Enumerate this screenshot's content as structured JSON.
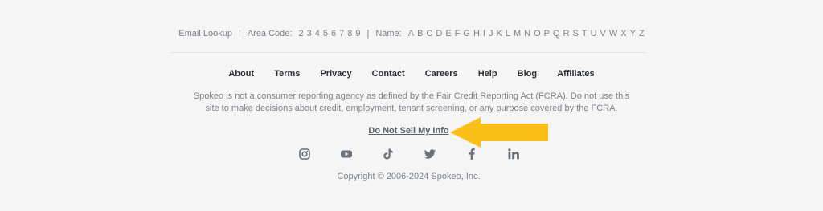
{
  "directory": {
    "email_lookup": "Email Lookup",
    "separator": "|",
    "area_code_label": "Area Code:",
    "area_codes": [
      "2",
      "3",
      "4",
      "5",
      "6",
      "7",
      "8",
      "9"
    ],
    "name_label": "Name:",
    "letters": [
      "A",
      "B",
      "C",
      "D",
      "E",
      "F",
      "G",
      "H",
      "I",
      "J",
      "K",
      "L",
      "M",
      "N",
      "O",
      "P",
      "Q",
      "R",
      "S",
      "T",
      "U",
      "V",
      "W",
      "X",
      "Y",
      "Z"
    ]
  },
  "nav": {
    "about": "About",
    "terms": "Terms",
    "privacy": "Privacy",
    "contact": "Contact",
    "careers": "Careers",
    "help": "Help",
    "blog": "Blog",
    "affiliates": "Affiliates"
  },
  "disclaimer": "Spokeo is not a consumer reporting agency as defined by the Fair Credit Reporting Act (FCRA). Do not use this site to make decisions about credit, employment, tenant screening, or any purpose covered by the FCRA.",
  "do_not_sell": "Do Not Sell My Info",
  "social": [
    "instagram-icon",
    "youtube-icon",
    "tiktok-icon",
    "twitter-icon",
    "facebook-icon",
    "linkedin-icon"
  ],
  "copyright": "Copyright © 2006-2024 Spokeo, Inc.",
  "colors": {
    "background": "#f5f5f5",
    "text_muted": "#7d838a",
    "nav_text": "#2b2f33",
    "icon": "#6b7178",
    "arrow": "#fbbf19"
  }
}
